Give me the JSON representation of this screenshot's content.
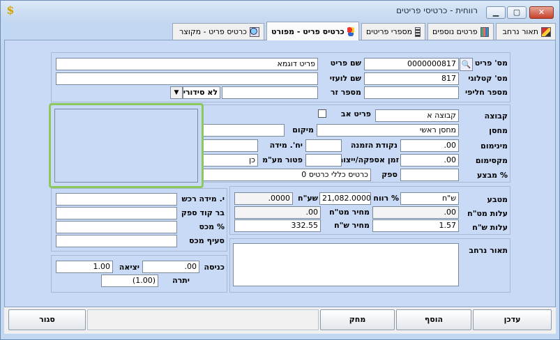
{
  "window": {
    "title": "רווחית - כרטיסי פריטים",
    "app_icon_glyph": "$",
    "controls": {
      "minimize": "▁",
      "maximize": "▢",
      "close": "✕"
    }
  },
  "tabs": [
    {
      "label": "תאור נרחב",
      "icon": "pencil-book-icon"
    },
    {
      "label": "פרטים נוספים",
      "icon": "grid-icon"
    },
    {
      "label": "מספרי פריטים",
      "icon": "list-icon"
    },
    {
      "label": "כרטיס פריט - מפורט",
      "icon": "balls-icon",
      "active": true
    },
    {
      "label": "כרטיס פריט - מקוצר",
      "icon": "magnifier-icon"
    }
  ],
  "top_panel": {
    "item_no_label": "מס' פריט",
    "item_no_value": "0000000817",
    "item_name_label": "שם פריט",
    "item_name_value": "פריט דוגמא",
    "catalog_label": "מס' קטלוגי",
    "catalog_value": "817",
    "foreign_name_label": "שם לועזי",
    "foreign_name_value": "",
    "alt_no_label": "מספר חליפי",
    "alt_no_value": "",
    "serial_label": "מספר זר",
    "serial_value": "",
    "serial_select_value": "לא סידורי"
  },
  "mid_panel": {
    "group_label": "קבוצה",
    "group_value": "קבוצה א",
    "parent_label": "פריט אב",
    "warehouse_label": "מחסן",
    "warehouse_value": "מחסן ראשי",
    "location_label": "מיקום",
    "location_value": "",
    "min_label": "מינימום",
    "min_value": ".00",
    "reorder_label": "נקודת הזמנה",
    "reorder_value": "",
    "unit_label": "יח'. מידה",
    "unit_value": "",
    "max_label": "מקסימום",
    "max_value": ".00",
    "lead_label": "זמן אספקה/ייצור",
    "lead_value": "",
    "vat_exempt_label": "פטור מע\"מ",
    "vat_exempt_value": "כן",
    "promo_label": "% מבצע",
    "promo_value": "",
    "supplier_label": "ספק",
    "supplier_value": "כרטיס כללי כרטיס 0"
  },
  "price_panel": {
    "currency_label": "מטבע",
    "currency_value": "ש\"ח",
    "profit_label": "% רווח",
    "profit_value": "21,082.0000",
    "rate_label": "שע\"ח",
    "rate_value": ".0000",
    "cost_fx_label": "עלות מט\"ח",
    "cost_fx_value": ".00",
    "price_fx_label": "מחיר מט\"ח",
    "price_fx_value": ".00",
    "cost_nis_label": "עלות ש\"ח",
    "cost_nis_value": "1.57",
    "price_nis_label": "מחיר ש\"ח",
    "price_nis_value": "332.55"
  },
  "left_panel": {
    "buy_unit_label": "י. מידה רכש",
    "barcode_label": "בר קוד ספק",
    "tax_pct_label": "% מכס",
    "tax_clause_label": "סעיף מכס"
  },
  "desc_panel": {
    "label": "תאור נרחב",
    "value": ""
  },
  "stock_panel": {
    "in_label": "כניסה",
    "in_value": ".00",
    "out_label": "יציאה",
    "out_value": "1.00",
    "balance_label": "יתרה",
    "balance_value": "(1.00)"
  },
  "buttons": {
    "update": "עדכן",
    "add": "הוסף",
    "delete": "מחק",
    "close": "סגור"
  }
}
